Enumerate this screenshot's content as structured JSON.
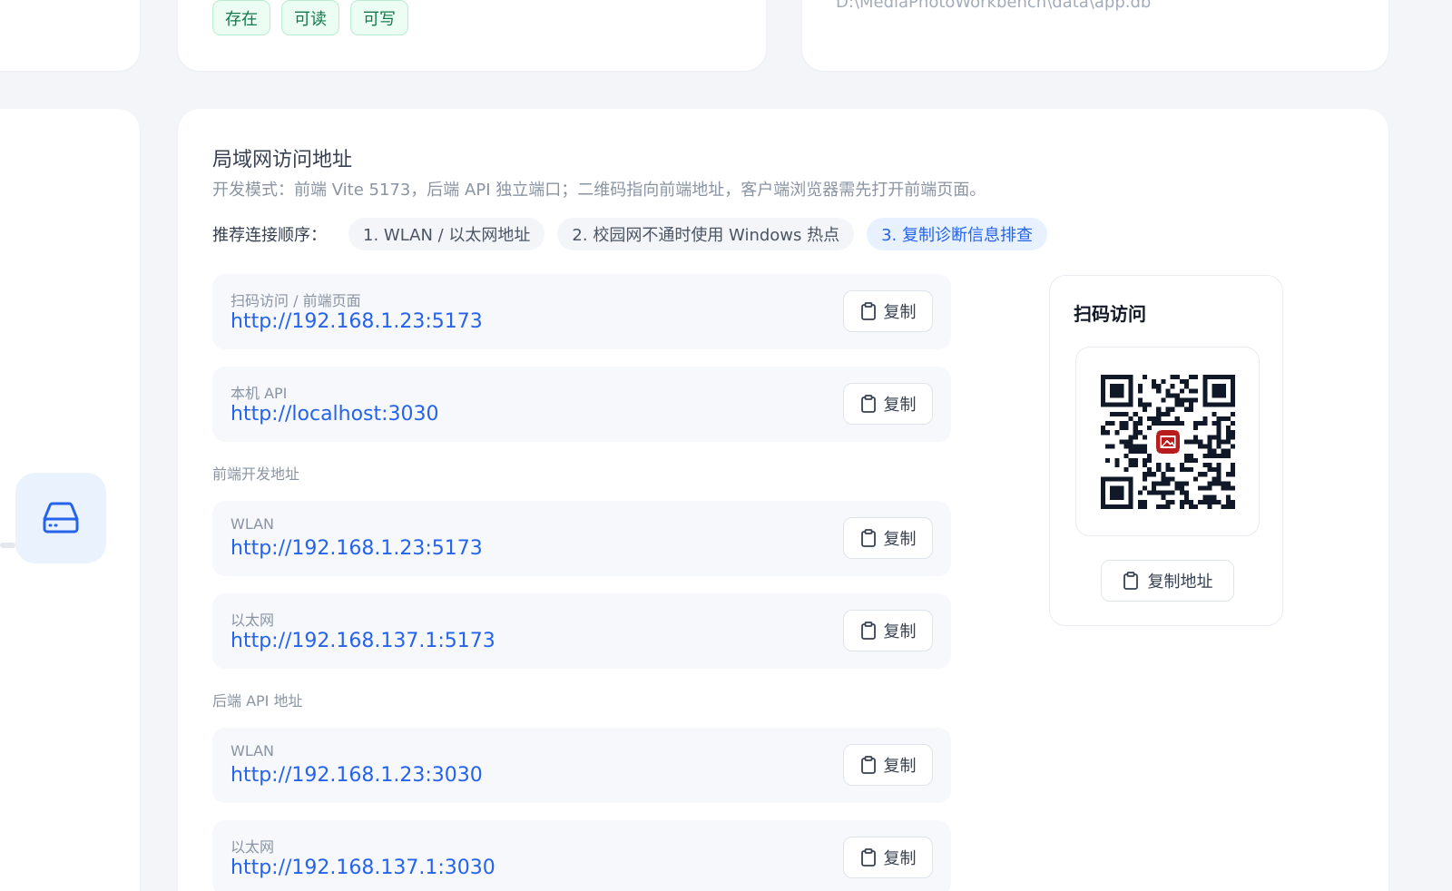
{
  "storage": {
    "tags": [
      "存在",
      "可读",
      "可写"
    ],
    "db_path": "D:\\MediaPhotoWorkbench\\data\\app.db"
  },
  "lan": {
    "title": "局域网访问地址",
    "description": "开发模式：前端 Vite 5173，后端 API 独立端口；二维码指向前端地址，客户端浏览器需先打开前端页面。",
    "order_label": "推荐连接顺序：",
    "order_steps": [
      "1. WLAN / 以太网地址",
      "2. 校园网不通时使用 Windows 热点",
      "3. 复制诊断信息排查"
    ],
    "copy_label": "复制",
    "primary": [
      {
        "label": "扫码访问 / 前端页面",
        "url": "http://192.168.1.23:5173"
      },
      {
        "label": "本机 API",
        "url": "http://localhost:3030"
      }
    ],
    "frontend_section": "前端开发地址",
    "frontend": [
      {
        "label": "WLAN",
        "url": "http://192.168.1.23:5173"
      },
      {
        "label": "以太网",
        "url": "http://192.168.137.1:5173"
      }
    ],
    "backend_section": "后端 API 地址",
    "backend": [
      {
        "label": "WLAN",
        "url": "http://192.168.1.23:3030"
      },
      {
        "label": "以太网",
        "url": "http://192.168.137.1:3030"
      }
    ]
  },
  "qr": {
    "title": "扫码访问",
    "copy_address_label": "复制地址"
  },
  "icons": {
    "rail": "hard-drive-icon",
    "copy": "clipboard-icon",
    "qr_center": "image-icon"
  },
  "colors": {
    "accent": "#2563eb",
    "tag_green": "#13794a",
    "qr_center": "#b91c1c"
  }
}
